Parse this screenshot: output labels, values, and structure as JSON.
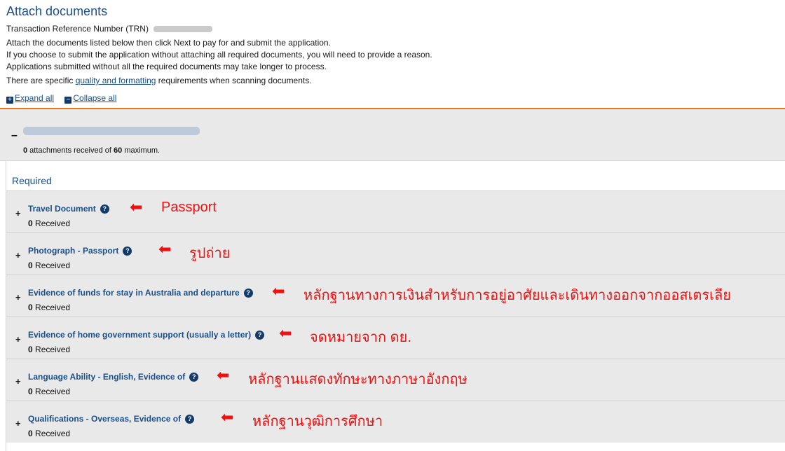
{
  "page": {
    "title": "Attach documents",
    "trn_label": "Transaction Reference Number (TRN)",
    "instructions": [
      "Attach the documents listed below then click Next to pay for and submit the application.",
      "If you choose to submit the application without attaching all required documents, you will need to provide a reason.",
      "Applications submitted without all the required documents may take longer to process."
    ],
    "quality_prefix": "There are specific ",
    "quality_link": "quality and formatting",
    "quality_suffix": " requirements when scanning documents."
  },
  "toggles": {
    "expand_icon": "+",
    "expand_label": "Expand all",
    "collapse_icon": "−",
    "collapse_label": "Collapse all"
  },
  "applicant": {
    "collapse_glyph": "–",
    "attachments_received": "0",
    "mid_text": " attachments received of ",
    "max": "60",
    "suffix": " maximum."
  },
  "required_label": "Required",
  "documents": [
    {
      "title": "Travel Document",
      "count": "0",
      "received_label": " Received",
      "annotation": "Passport"
    },
    {
      "title": "Photograph - Passport",
      "count": "0",
      "received_label": " Received",
      "annotation": "รูปถ่าย"
    },
    {
      "title": "Evidence of funds for stay in Australia and departure",
      "count": "0",
      "received_label": " Received",
      "annotation": "หลักฐานทางการเงินสำหรับการอยู่อาศัยและเดินทางออกจากออสเตรเลีย"
    },
    {
      "title": "Evidence of home government support (usually a letter)",
      "count": "0",
      "received_label": " Received",
      "annotation": "จดหมายจาก ดย."
    },
    {
      "title": "Language Ability - English, Evidence of",
      "count": "0",
      "received_label": " Received",
      "annotation": "หลักฐานแสดงทักษะทางภาษาอังกฤษ"
    },
    {
      "title": "Qualifications - Overseas, Evidence of",
      "count": "0",
      "received_label": " Received",
      "annotation": "หลักฐานวุฒิการศึกษา"
    }
  ],
  "icons": {
    "help": "?",
    "plus": "+",
    "arrow": "⬅"
  },
  "colors": {
    "link_blue": "#1a4f8a",
    "accent_orange": "#e77817",
    "annotation_red": "#ee1111",
    "row_gray": "#e9e9e9"
  }
}
